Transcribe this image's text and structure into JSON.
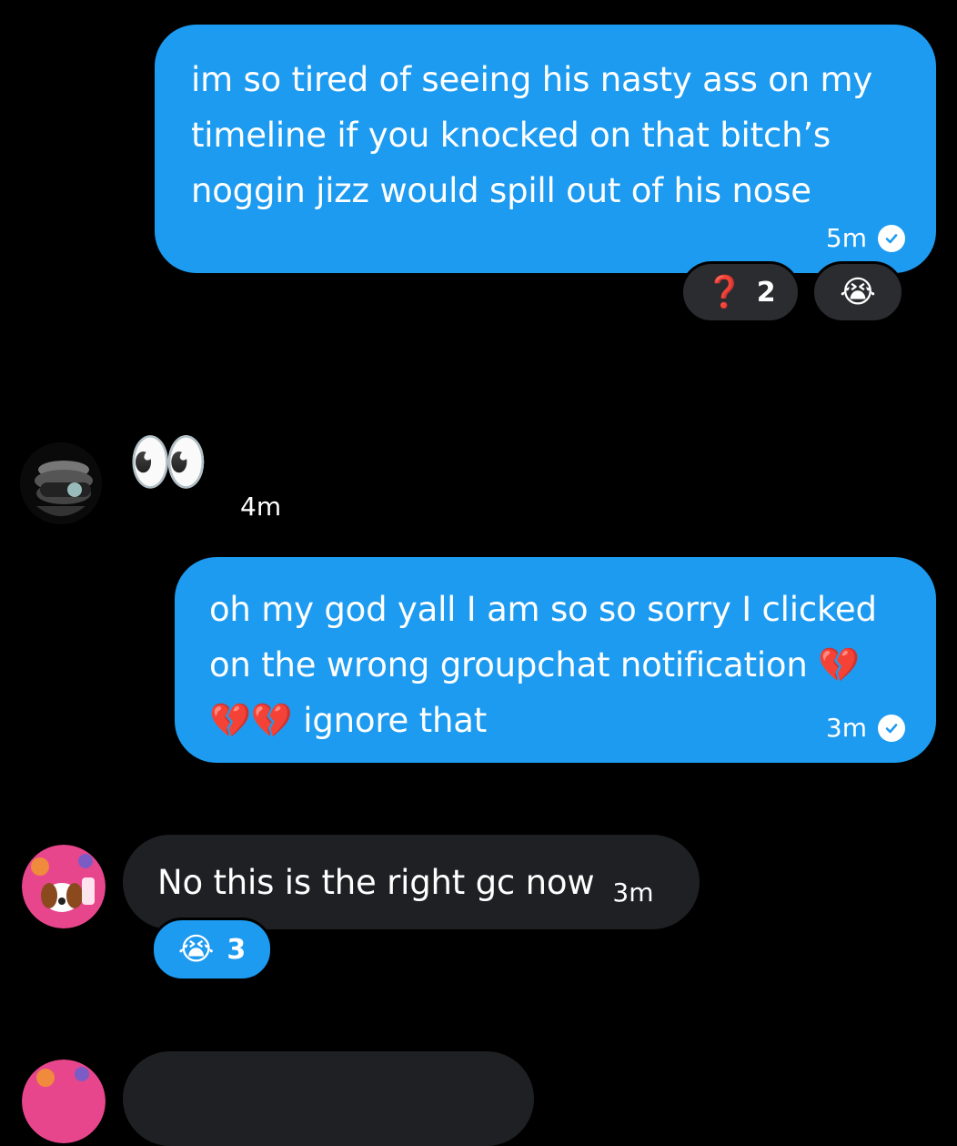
{
  "messages": [
    {
      "text": "im so tired of seeing his nasty ass on my timeline if you knocked on that bitch’s noggin jizz would spill out of his nose",
      "time": "5m",
      "reactions": [
        {
          "emoji": "❓",
          "count": "2"
        },
        {
          "emoji": "😭",
          "count": ""
        }
      ]
    },
    {
      "emoji": "👀",
      "time": "4m"
    },
    {
      "text_lines": [
        "oh my god yall I am so so sorry I clicked",
        "on the wrong groupchat notification 💔",
        "💔💔 ignore that"
      ],
      "time": "3m"
    },
    {
      "text": "No this is the right gc now",
      "time": "3m",
      "reactions": [
        {
          "emoji": "😭",
          "count": "3"
        }
      ]
    }
  ],
  "colors": {
    "outgoing_bubble": "#1d9bf0",
    "incoming_bubble": "#1f2023",
    "background": "#000000",
    "reaction_dark": "#2b2c30"
  },
  "icons": [
    "sent-check-icon",
    "avatar-helmet",
    "avatar-dog-sticker"
  ]
}
